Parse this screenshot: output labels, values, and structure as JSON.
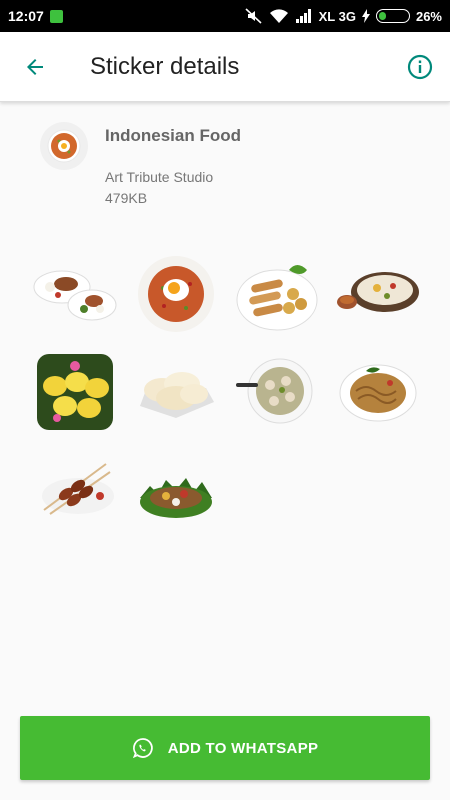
{
  "status_bar": {
    "time": "12:07",
    "carrier": "XL 3G",
    "battery": "26%",
    "battery_level": 0.26
  },
  "app_bar": {
    "title": "Sticker details",
    "back_icon": "arrow-left-icon",
    "info_icon": "info-icon"
  },
  "pack": {
    "name": "Indonesian Food",
    "publisher": "Art Tribute Studio",
    "size": "479KB"
  },
  "stickers": [
    "nasi-campur-sticker",
    "nasi-goreng-sticker",
    "spring-rolls-sticker",
    "nasi-uduk-sticker",
    "kue-sticker",
    "krupuk-sticker",
    "bakso-sticker",
    "mie-goreng-sticker",
    "sate-sticker",
    "tumpeng-sticker"
  ],
  "add_button": {
    "label": "ADD TO WHATSAPP",
    "icon": "whatsapp-icon"
  },
  "colors": {
    "accent": "#00897b",
    "button": "#46bb33"
  }
}
